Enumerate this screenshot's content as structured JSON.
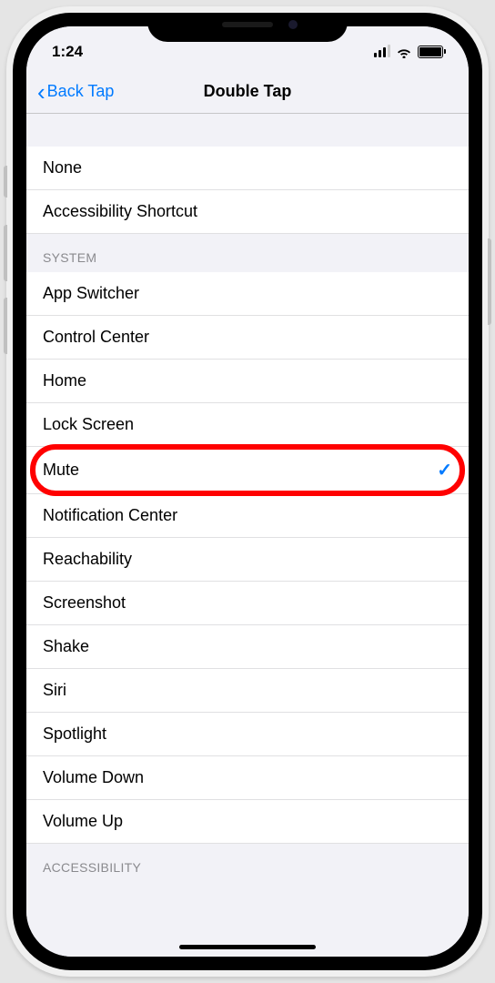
{
  "status": {
    "time": "1:24"
  },
  "nav": {
    "back_label": "Back Tap",
    "title": "Double Tap"
  },
  "sections": [
    {
      "header": null,
      "items": [
        {
          "label": "None",
          "selected": false
        },
        {
          "label": "Accessibility Shortcut",
          "selected": false
        }
      ]
    },
    {
      "header": "SYSTEM",
      "items": [
        {
          "label": "App Switcher",
          "selected": false
        },
        {
          "label": "Control Center",
          "selected": false
        },
        {
          "label": "Home",
          "selected": false
        },
        {
          "label": "Lock Screen",
          "selected": false
        },
        {
          "label": "Mute",
          "selected": true,
          "highlighted": true
        },
        {
          "label": "Notification Center",
          "selected": false
        },
        {
          "label": "Reachability",
          "selected": false
        },
        {
          "label": "Screenshot",
          "selected": false
        },
        {
          "label": "Shake",
          "selected": false
        },
        {
          "label": "Siri",
          "selected": false
        },
        {
          "label": "Spotlight",
          "selected": false
        },
        {
          "label": "Volume Down",
          "selected": false
        },
        {
          "label": "Volume Up",
          "selected": false
        }
      ]
    },
    {
      "header": "ACCESSIBILITY",
      "items": []
    }
  ]
}
